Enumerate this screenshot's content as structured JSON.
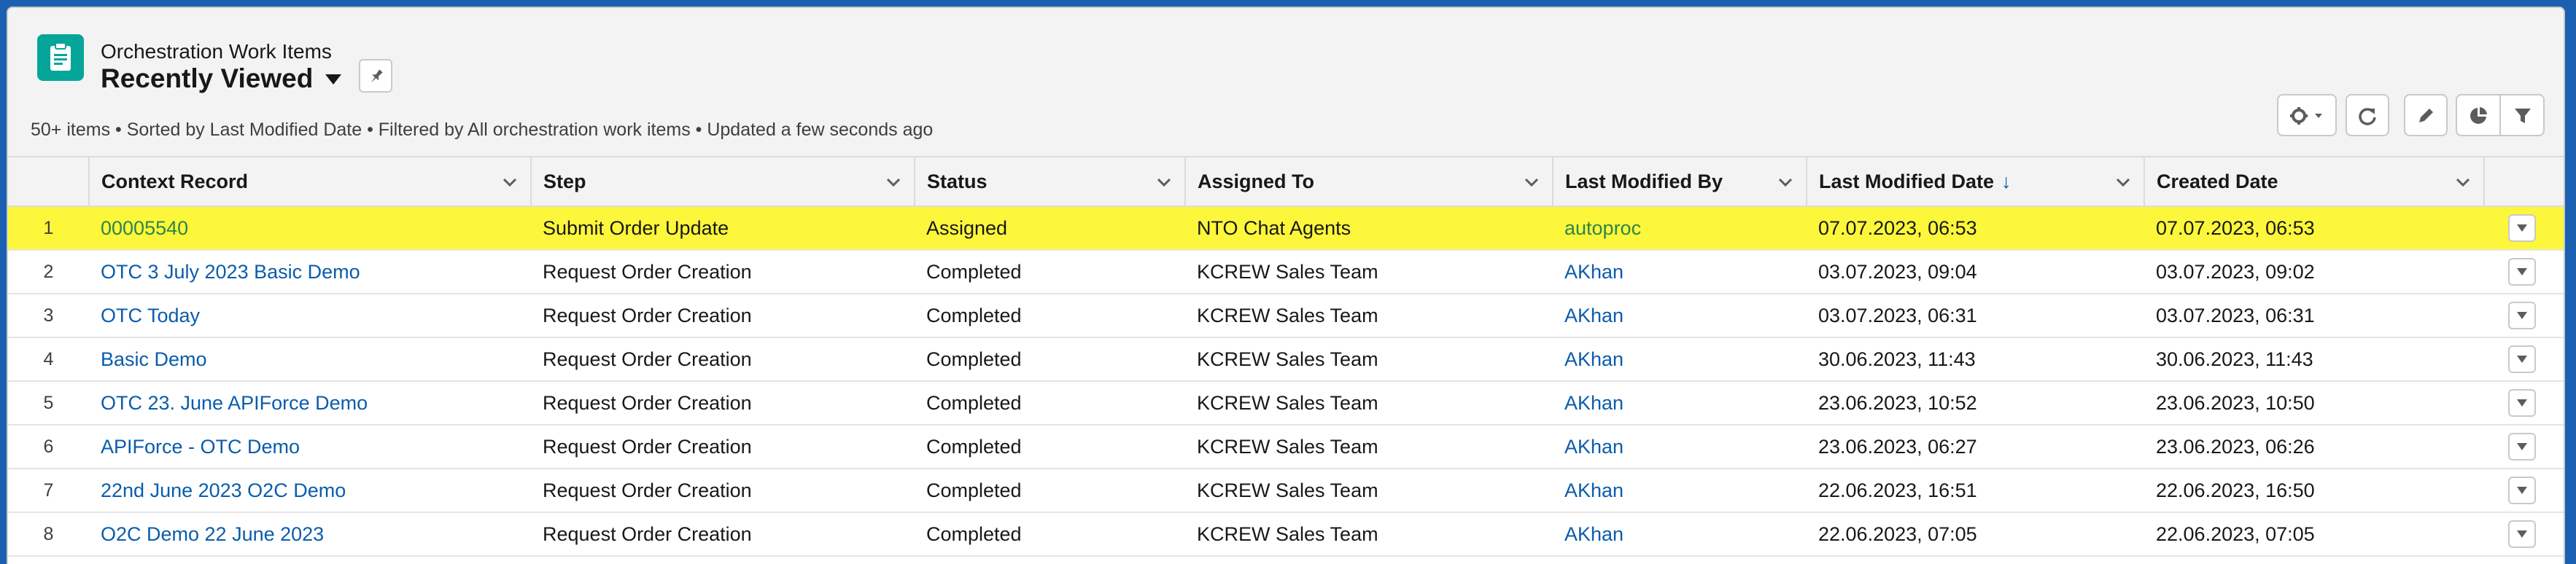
{
  "header": {
    "object_label": "Orchestration Work Items",
    "list_view": "Recently Viewed",
    "meta": "50+ items • Sorted by Last Modified Date • Filtered by All orchestration work items • Updated a few seconds ago"
  },
  "toolbar": {
    "icons": [
      "gear-icon",
      "refresh-icon",
      "edit-icon",
      "chart-icon",
      "filter-icon"
    ]
  },
  "columns": [
    "Context Record",
    "Step",
    "Status",
    "Assigned To",
    "Last Modified By",
    "Last Modified Date",
    "Created Date"
  ],
  "sort": {
    "column": "Last Modified Date",
    "arrow": "↓"
  },
  "colors": {
    "accent": "#0b5cab",
    "highlight": "#fdf73b",
    "icon_bg": "#06a59a"
  },
  "rows": [
    {
      "num": "1",
      "context": "00005540",
      "step": "Submit Order Update",
      "status": "Assigned",
      "assigned": "NTO Chat Agents",
      "modified_by": "autoproc",
      "modified": "07.07.2023, 06:53",
      "created": "07.07.2023, 06:53"
    },
    {
      "num": "2",
      "context": "OTC 3 July 2023 Basic Demo",
      "step": "Request Order Creation",
      "status": "Completed",
      "assigned": "KCREW Sales Team",
      "modified_by": "AKhan",
      "modified": "03.07.2023, 09:04",
      "created": "03.07.2023, 09:02"
    },
    {
      "num": "3",
      "context": "OTC Today",
      "step": "Request Order Creation",
      "status": "Completed",
      "assigned": "KCREW Sales Team",
      "modified_by": "AKhan",
      "modified": "03.07.2023, 06:31",
      "created": "03.07.2023, 06:31"
    },
    {
      "num": "4",
      "context": "Basic Demo",
      "step": "Request Order Creation",
      "status": "Completed",
      "assigned": "KCREW Sales Team",
      "modified_by": "AKhan",
      "modified": "30.06.2023, 11:43",
      "created": "30.06.2023, 11:43"
    },
    {
      "num": "5",
      "context": "OTC 23. June APIForce Demo",
      "step": "Request Order Creation",
      "status": "Completed",
      "assigned": "KCREW Sales Team",
      "modified_by": "AKhan",
      "modified": "23.06.2023, 10:52",
      "created": "23.06.2023, 10:50"
    },
    {
      "num": "6",
      "context": "APIForce - OTC Demo",
      "step": "Request Order Creation",
      "status": "Completed",
      "assigned": "KCREW Sales Team",
      "modified_by": "AKhan",
      "modified": "23.06.2023, 06:27",
      "created": "23.06.2023, 06:26"
    },
    {
      "num": "7",
      "context": "22nd June 2023 O2C Demo",
      "step": "Request Order Creation",
      "status": "Completed",
      "assigned": "KCREW Sales Team",
      "modified_by": "AKhan",
      "modified": "22.06.2023, 16:51",
      "created": "22.06.2023, 16:50"
    },
    {
      "num": "8",
      "context": "O2C Demo 22 June 2023",
      "step": "Request Order Creation",
      "status": "Completed",
      "assigned": "KCREW Sales Team",
      "modified_by": "AKhan",
      "modified": "22.06.2023, 07:05",
      "created": "22.06.2023, 07:05"
    }
  ]
}
